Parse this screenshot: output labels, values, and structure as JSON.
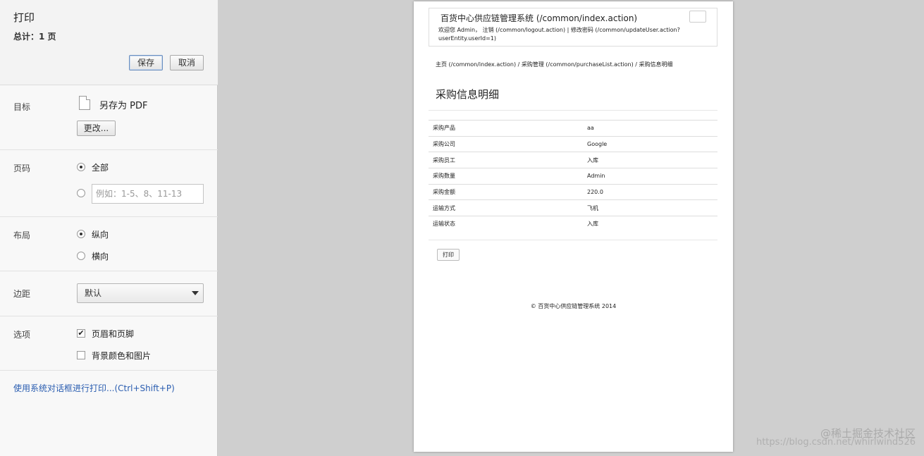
{
  "panel": {
    "title": "打印",
    "total": "总计：1 页",
    "save_button": "保存",
    "cancel_button": "取消",
    "destination": {
      "label": "目标",
      "value": "另存为 PDF",
      "change_button": "更改..."
    },
    "pages": {
      "label": "页码",
      "all": "全部",
      "custom_placeholder": "例如：1-5、8、11-13",
      "selected": "全部"
    },
    "layout": {
      "label": "布局",
      "portrait": "纵向",
      "landscape": "横向",
      "selected": "纵向"
    },
    "margins": {
      "label": "边距",
      "value": "默认"
    },
    "options": {
      "label": "选项",
      "headers_footers": "页眉和页脚",
      "headers_footers_checked": true,
      "background": "背景颜色和图片",
      "background_checked": false
    },
    "system_dialog_link": "使用系统对话框进行打印...(Ctrl+Shift+P)"
  },
  "preview": {
    "system_title": "百货中心供应链管理系统 (/common/index.action)",
    "welcome": "欢迎您 Admin， 注销 (/common/logout.action) | 修改密码 (/common/updateUser.action?userEntity.userId=1)",
    "breadcrumb": "主页 (/common/index.action)  /  采购管理 (/common/purchaseList.action)  /  采购信息明细",
    "page_title": "采购信息明细",
    "rows": [
      {
        "label": "采购产品",
        "value": "aa"
      },
      {
        "label": "采购公司",
        "value": "Google"
      },
      {
        "label": "采购员工",
        "value": "入库"
      },
      {
        "label": "采购数量",
        "value": "Admin"
      },
      {
        "label": "采购金额",
        "value": "220.0"
      },
      {
        "label": "运输方式",
        "value": "飞机"
      },
      {
        "label": "运输状态",
        "value": "入库"
      }
    ],
    "print_button": "打印",
    "footer": "© 百货中心供应链管理系统 2014"
  },
  "watermark": {
    "line1": "@稀土掘金技术社区",
    "line2": "https://blog.csdn.net/whirlwind526"
  }
}
